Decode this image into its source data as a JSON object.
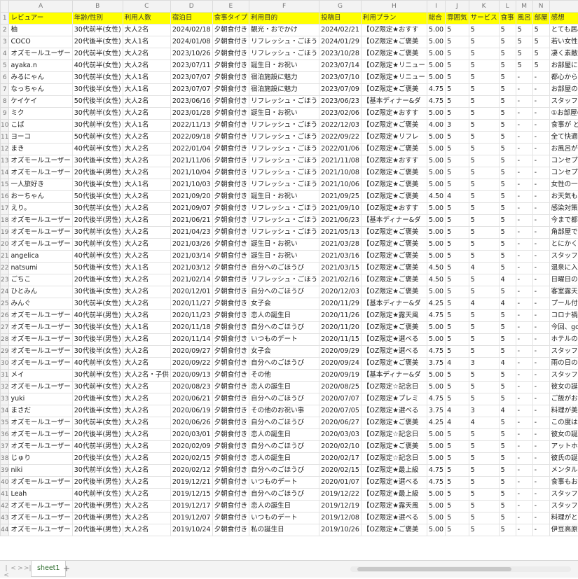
{
  "columns": [
    "A",
    "B",
    "C",
    "D",
    "E",
    "F",
    "G",
    "H",
    "I",
    "J",
    "K",
    "L",
    "M",
    "N",
    "O"
  ],
  "header": [
    "レビュアー",
    "年齢/性別",
    "利用人数",
    "宿泊日",
    "食事タイプ",
    "利用目的",
    "投稿日",
    "利用プラン",
    "総合",
    "雰囲気",
    "サービス",
    "食事",
    "風呂",
    "部屋",
    "感想"
  ],
  "rows": [
    [
      "柚",
      "30代前半(女性)",
      "大人2名",
      "2024/02/18",
      "夕朝食付き",
      "観光・おでかけ",
      "2024/02/21",
      "【OZ限定★おすす",
      "5.00",
      "5",
      "5",
      "5",
      "5",
      "5",
      "とても居心地のよいホテルでした。料理が美味しすぎ"
    ],
    [
      "COCO",
      "20代後半(女性)",
      "大人1名",
      "2024/01/08",
      "夕朝食付き",
      "リフレッシュ・ごほう",
      "2024/01/29",
      "【OZ限定★ご褒美",
      "5.00",
      "5",
      "5",
      "5",
      "5",
      "5",
      "若い女性のひとり旅にも最適な宿。日々の疲れを癒し"
    ],
    [
      "オズモールユーザー",
      "20代前半(女性)",
      "大人2名",
      "2023/10/26",
      "夕朝食付き",
      "リフレッシュ・ごほう",
      "2023/10/28",
      "【OZ限定★ご褒美",
      "5.00",
      "5",
      "5",
      "5",
      "5",
      "5",
      "凄く素敵な部屋、料理でした。サービスも丁寧で、お"
    ],
    [
      "ayaka.n",
      "40代前半(女性)",
      "大人2名",
      "2023/07/11",
      "夕朝食付き",
      "誕生日・お祝い",
      "2023/07/14",
      "【OZ限定★リニュー",
      "5.00",
      "5",
      "5",
      "5",
      "5",
      "5",
      "お部屋についているプールが、とても気持ちよかった"
    ],
    [
      "みるにゃん",
      "30代前半(女性)",
      "大人1名",
      "2023/07/07",
      "夕朝食付き",
      "宿泊施設に魅力",
      "2023/07/10",
      "【OZ限定★リニュー",
      "5.00",
      "5",
      "5",
      "5",
      "-",
      "-",
      "都心から2時間でリゾート感を味わえるホテル。どこか"
    ],
    [
      "なっちゃん",
      "30代後半(女性)",
      "大人1名",
      "2023/07/07",
      "夕朝食付き",
      "宿泊施設に魅力",
      "2023/07/09",
      "【OZ限定★ご褒美",
      "4.75",
      "5",
      "5",
      "5",
      "-",
      "-",
      "お部屋の露天風呂の温泉が自分で変えられます。お部"
    ],
    [
      "ケイケイ",
      "50代後半(女性)",
      "大人2名",
      "2023/06/16",
      "夕朝食付き",
      "リフレッシュ・ごほう",
      "2023/06/23",
      "【基本ディナー&ダ",
      "4.75",
      "5",
      "5",
      "5",
      "-",
      "-",
      "スタッフの方が親切です。暑い日に1時間も早く着いて"
    ],
    [
      "ミク",
      "30代前半(女性)",
      "大人2名",
      "2023/01/28",
      "夕朝食付き",
      "誕生日・お祝い",
      "2023/02/06",
      "【OZ限定★おすす",
      "5.00",
      "5",
      "5",
      "5",
      "-",
      "-",
      "①お部屋の可愛さ。②料理。③温泉。④スタッフさ"
    ],
    [
      "こば",
      "30代前半(女性)",
      "大人1名",
      "2022/11/13",
      "夕朝食付き",
      "リフレッシュ・ごほう",
      "2022/12/03",
      "【OZ限定★ご褒美",
      "4.00",
      "3",
      "5",
      "5",
      "-",
      "-",
      "食事が どれも美味しく大満足です。夕飯のベストトー"
    ],
    [
      "ヨーコ",
      "50代前半(女性)",
      "大人2名",
      "2022/09/18",
      "夕朝食付き",
      "リフレッシュ・ごほう",
      "2022/09/22",
      "【OZ限定★リフレ",
      "5.00",
      "5",
      "5",
      "5",
      "-",
      "-",
      "全て快適でした。食事も大変おいしくて、女性二人で"
    ],
    [
      "まき",
      "40代前半(女性)",
      "大人2名",
      "2022/01/04",
      "夕朝食付き",
      "リフレッシュ・ごほう",
      "2022/01/06",
      "【OZ限定★ご褒美",
      "5.00",
      "5",
      "5",
      "5",
      "-",
      "-",
      "お風呂が、すごくいい湯で何回も入りました。そして"
    ],
    [
      "オズモールユーザー",
      "30代後半(女性)",
      "大人2名",
      "2021/11/06",
      "夕朝食付き",
      "リフレッシュ・ごほう",
      "2021/11/08",
      "【OZ限定★おすす",
      "5.00",
      "5",
      "5",
      "5",
      "-",
      "-",
      "コンセプトに沿ったお部屋で雰囲気がとても良く(スタ"
    ],
    [
      "オズモールユーザー",
      "20代後半(男性)",
      "大人2名",
      "2021/10/04",
      "夕朝食付き",
      "リフレッシュ・ごほう",
      "2021/10/08",
      "【OZ限定★ご褒美",
      "5.00",
      "5",
      "5",
      "5",
      "-",
      "-",
      "コンセプトに沿ったお部屋で雰囲気がとても良く(スタ"
    ],
    [
      "一人旅好き",
      "30代後半(女性)",
      "大人1名",
      "2021/10/03",
      "夕朝食付き",
      "リフレッシュ・ごほう",
      "2021/10/06",
      "【OZ限定★ご褒美",
      "5.00",
      "5",
      "5",
      "5",
      "-",
      "-",
      "女性の一人旅でした。まず、スタッフの方がとても丁"
    ],
    [
      "おーちゃん",
      "50代後半(女性)",
      "大人2名",
      "2021/09/20",
      "夕朝食付き",
      "誕生日・お祝い",
      "2021/09/25",
      "【OZ限定★ご褒美",
      "4.50",
      "4",
      "5",
      "5",
      "-",
      "-",
      "お天気もよく気温もちょうどいい時期でしたので散歩"
    ],
    [
      "えり。",
      "30代前半(女性)",
      "大人2名",
      "2021/09/07",
      "夕朝食付き",
      "リフレッシュ・ごほう",
      "2021/09/10",
      "【OZ限定★おすす",
      "5.00",
      "5",
      "5",
      "5",
      "-",
      "-",
      "感染対策もしっかりしていて、部屋食で、しかも、お"
    ],
    [
      "オズモールユーザー",
      "20代後半(男性)",
      "大人2名",
      "2021/06/21",
      "夕朝食付き",
      "リフレッシュ・ごほう",
      "2021/06/23",
      "【基本ディナー&ダ",
      "5.00",
      "5",
      "5",
      "5",
      "-",
      "-",
      "今まで都内で食べてきたイタリアン、フレンチでは香"
    ],
    [
      "オズモールユーザー",
      "30代前半(女性)",
      "大人2名",
      "2021/04/23",
      "夕朝食付き",
      "リフレッシュ・ごほう",
      "2021/05/13",
      "【OZ限定★ご褒美",
      "5.00",
      "5",
      "5",
      "5",
      "-",
      "-",
      "角部屋で日当たりも良く、バルコニーで露天風呂に浸"
    ],
    [
      "オズモールユーザー",
      "30代前半(女性)",
      "大人2名",
      "2021/03/26",
      "夕朝食付き",
      "誕生日・お祝い",
      "2021/03/28",
      "【OZ限定★ご褒美",
      "5.00",
      "5",
      "5",
      "5",
      "-",
      "-",
      "とにかくスタッフさんの対応がとてもよかったです！"
    ],
    [
      "angelica",
      "40代前半(女性)",
      "大人2名",
      "2021/03/14",
      "夕朝食付き",
      "誕生日・お祝い",
      "2021/03/16",
      "【OZ限定★ご褒美",
      "5.00",
      "5",
      "5",
      "5",
      "-",
      "-",
      "スタッフの方も温かく迎えてくださいます。お部屋も"
    ],
    [
      "natsumi",
      "50代後半(女性)",
      "大人1名",
      "2021/03/12",
      "夕朝食付き",
      "自分へのごほうび",
      "2021/03/15",
      "【OZ限定★ご褒美",
      "4.50",
      "5",
      "4",
      "5",
      "-",
      "-",
      "温泉に入りたくて、宿泊しました。お部屋のベランダ"
    ],
    [
      "ごちこ",
      "20代後半(女性)",
      "大人2名",
      "2021/02/14",
      "夕朝食付き",
      "リフレッシュ・ごほう",
      "2021/02/16",
      "【OZ限定★ご褒美",
      "4.50",
      "5",
      "5",
      "4",
      "-",
      "-",
      "日曜日の宿泊だったからか、他のお客さんに会うこと"
    ],
    [
      "ひとみん",
      "30代後半(女性)",
      "大人2名",
      "2020/12/01",
      "夕朝食付き",
      "自分へのごほうび",
      "2020/12/03",
      "【OZ限定★ご褒美",
      "5.00",
      "5",
      "5",
      "5",
      "-",
      "-",
      "客室露天風呂付きで共用エリアのお風呂も貸切予約制"
    ],
    [
      "みんぐ",
      "30代前半(女性)",
      "大人2名",
      "2020/11/27",
      "夕朝食付き",
      "女子会",
      "2020/11/29",
      "【基本ディナー&ダ",
      "4.25",
      "5",
      "4",
      "4",
      "-",
      "-",
      "プール付きのお部屋で食事を部屋食にして頂きとても"
    ],
    [
      "オズモールユーザー",
      "40代前半(男性)",
      "大人2名",
      "2020/11/23",
      "夕朝食付き",
      "恋人の誕生日",
      "2020/11/26",
      "【OZ限定★露天風",
      "4.75",
      "5",
      "5",
      "5",
      "-",
      "-",
      "コロナ禍の中行こう迷いましたが行って良かったです"
    ],
    [
      "オズモールユーザー",
      "30代後半(女性)",
      "大人1名",
      "2020/11/18",
      "夕朝食付き",
      "自分へのごほうび",
      "2020/11/20",
      "【OZ限定★ご褒美",
      "5.00",
      "5",
      "5",
      "5",
      "-",
      "-",
      "今回、gotoを利用して宿泊させていただきました。お"
    ],
    [
      "オズモールユーザー",
      "30代後半(男性)",
      "大人2名",
      "2020/11/14",
      "夕朝食付き",
      "いつものデート",
      "2020/11/15",
      "【OZ限定★選べる",
      "5.00",
      "5",
      "5",
      "5",
      "-",
      "-",
      "ホテルの方が親切で、アットホームであたたかかった"
    ],
    [
      "オズモールユーザー",
      "30代後半(女性)",
      "大人2名",
      "2020/09/27",
      "夕朝食付き",
      "女子会",
      "2020/09/29",
      "【OZ限定★選べる",
      "4.75",
      "5",
      "5",
      "5",
      "-",
      "-",
      "スタッフさんたちもみなさん親切で優しく、お部屋も"
    ],
    [
      "オズモールユーザー",
      "40代前半(女性)",
      "大人2名",
      "2020/09/22",
      "夕朝食付き",
      "自分へのごほうび",
      "2020/09/24",
      "【OZ限定★ご褒美",
      "3.75",
      "4",
      "3",
      "4",
      "-",
      "-",
      "雨の日の利用でしたが、到着したら傘を持って迎えに"
    ],
    [
      "メイ",
      "30代前半(女性)",
      "大人2名・子供",
      "2020/09/13",
      "夕朝食付き",
      "その他",
      "2020/09/19",
      "【基本ディナー&ダ",
      "5.00",
      "5",
      "5",
      "5",
      "-",
      "-",
      "スタッフ皆さま親切で、食事も美味しかったです。ブ"
    ],
    [
      "オズモールユーザー",
      "30代前半(女性)",
      "大人2名",
      "2020/08/23",
      "夕朝食付き",
      "恋人の誕生日",
      "2020/08/25",
      "【OZ限定☆記念日",
      "5.00",
      "5",
      "5",
      "5",
      "-",
      "-",
      "彼女の誕生日に利用させて頂きました。お部屋の雰囲"
    ],
    [
      "yuki",
      "20代後半(女性)",
      "大人2名",
      "2020/06/21",
      "夕朝食付き",
      "自分へのごほうび",
      "2020/07/07",
      "【OZ限定★プレミ",
      "4.75",
      "5",
      "5",
      "5",
      "-",
      "-",
      "ご飯がおいしく、のんびりと良い時間を過ごせました"
    ],
    [
      "まさだ",
      "20代後半(女性)",
      "大人2名",
      "2020/06/19",
      "夕朝食付き",
      "その他のお祝い事",
      "2020/07/05",
      "【OZ限定★選べる",
      "3.75",
      "4",
      "3",
      "4",
      "-",
      "-",
      "料理が美味しいです。従業員さんの対応も親切でした"
    ],
    [
      "オズモールユーザー",
      "30代前半(女性)",
      "大人2名",
      "2020/06/26",
      "夕朝食付き",
      "自分へのごほうび",
      "2020/06/27",
      "【OZ限定★ご褒美",
      "4.25",
      "4",
      "4",
      "5",
      "-",
      "-",
      "この度はお世話になりました。雰囲気がとても素敵で"
    ],
    [
      "オズモールユーザー",
      "20代後半(男性)",
      "大人2名",
      "2020/03/01",
      "夕朝食付き",
      "恋人の誕生日",
      "2020/03/03",
      "【OZ限定☆記念日",
      "5.00",
      "5",
      "5",
      "5",
      "-",
      "-",
      "彼女の誕生日に利用いたしました。宿はぐらんぱる公"
    ],
    [
      "オズモールユーザー",
      "40代前半(男性)",
      "大人2名",
      "2020/02/09",
      "夕朝食付き",
      "自分へのごほうび",
      "2020/02/10",
      "【OZ限定★ご褒美",
      "5.00",
      "5",
      "5",
      "5",
      "-",
      "-",
      "アットホームな雰囲気で、心地よい時間を過ごせまし"
    ],
    [
      "じゅり",
      "20代後半(女性)",
      "大人2名",
      "2020/02/15",
      "夕朝食付き",
      "恋人の誕生日",
      "2020/02/17",
      "【OZ限定☆記念日",
      "5.00",
      "5",
      "5",
      "5",
      "-",
      "-",
      "彼氏の誕生日で7イランドスイートに泊まらせていた"
    ],
    [
      "niki",
      "30代前半(女性)",
      "大人2名",
      "2020/02/12",
      "夕朝食付き",
      "自分へのごほうび",
      "2020/02/15",
      "【OZ限定★最上級",
      "4.75",
      "5",
      "5",
      "5",
      "-",
      "-",
      "メンタルの病気を患ってしまったので、リフレッシュ"
    ],
    [
      "オズモールユーザー",
      "20代後半(男性)",
      "大人2名",
      "2019/12/21",
      "夕朝食付き",
      "いつものデート",
      "2020/01/07",
      "【OZ限定★選べる",
      "4.75",
      "5",
      "5",
      "5",
      "-",
      "-",
      "食事もお部屋も素晴らしいです。スタッフの対応もと"
    ],
    [
      "Leah",
      "40代前半(女性)",
      "大人2名",
      "2019/12/15",
      "夕朝食付き",
      "自分へのごほうび",
      "2019/12/22",
      "【OZ限定★最上級",
      "5.00",
      "5",
      "5",
      "5",
      "-",
      "-",
      "スタッフみなさま一人一人が笑顔で出迎えて下さり、"
    ],
    [
      "オズモールユーザー",
      "20代後半(男性)",
      "大人2名",
      "2019/12/17",
      "夕朝食付き",
      "恋人の誕生日",
      "2019/12/19",
      "【OZ限定★露天風",
      "5.00",
      "5",
      "5",
      "5",
      "-",
      "-",
      "スタッフの対応がとてもよかったです。お食事も大変"
    ],
    [
      "オズモールユーザー",
      "20代後半(男性)",
      "大人2名",
      "2019/12/07",
      "夕朝食付き",
      "いつものデート",
      "2019/12/08",
      "【OZ限定★選べる",
      "5.00",
      "5",
      "5",
      "5",
      "-",
      "-",
      "料理がとても美味しく、宿の方もとても親切でした。"
    ],
    [
      "オズモールユーザー",
      "20代後半(男性)",
      "大人2名",
      "2019/10/24",
      "夕朝食付き",
      "私の誕生日",
      "2019/10/26",
      "【OZ限定★ご褒美",
      "5.00",
      "5",
      "5",
      "5",
      "-",
      "-",
      "伊豆高原には年に数回行くのですが、こんな素敵な宿"
    ]
  ],
  "sheet_tab": "sheet1",
  "add_sheet": "+",
  "nav_buttons": [
    "|<",
    "<",
    ">",
    ">|"
  ],
  "colors": {
    "header_fill": "#ffff00",
    "tab_text": "#2a6a2a"
  }
}
